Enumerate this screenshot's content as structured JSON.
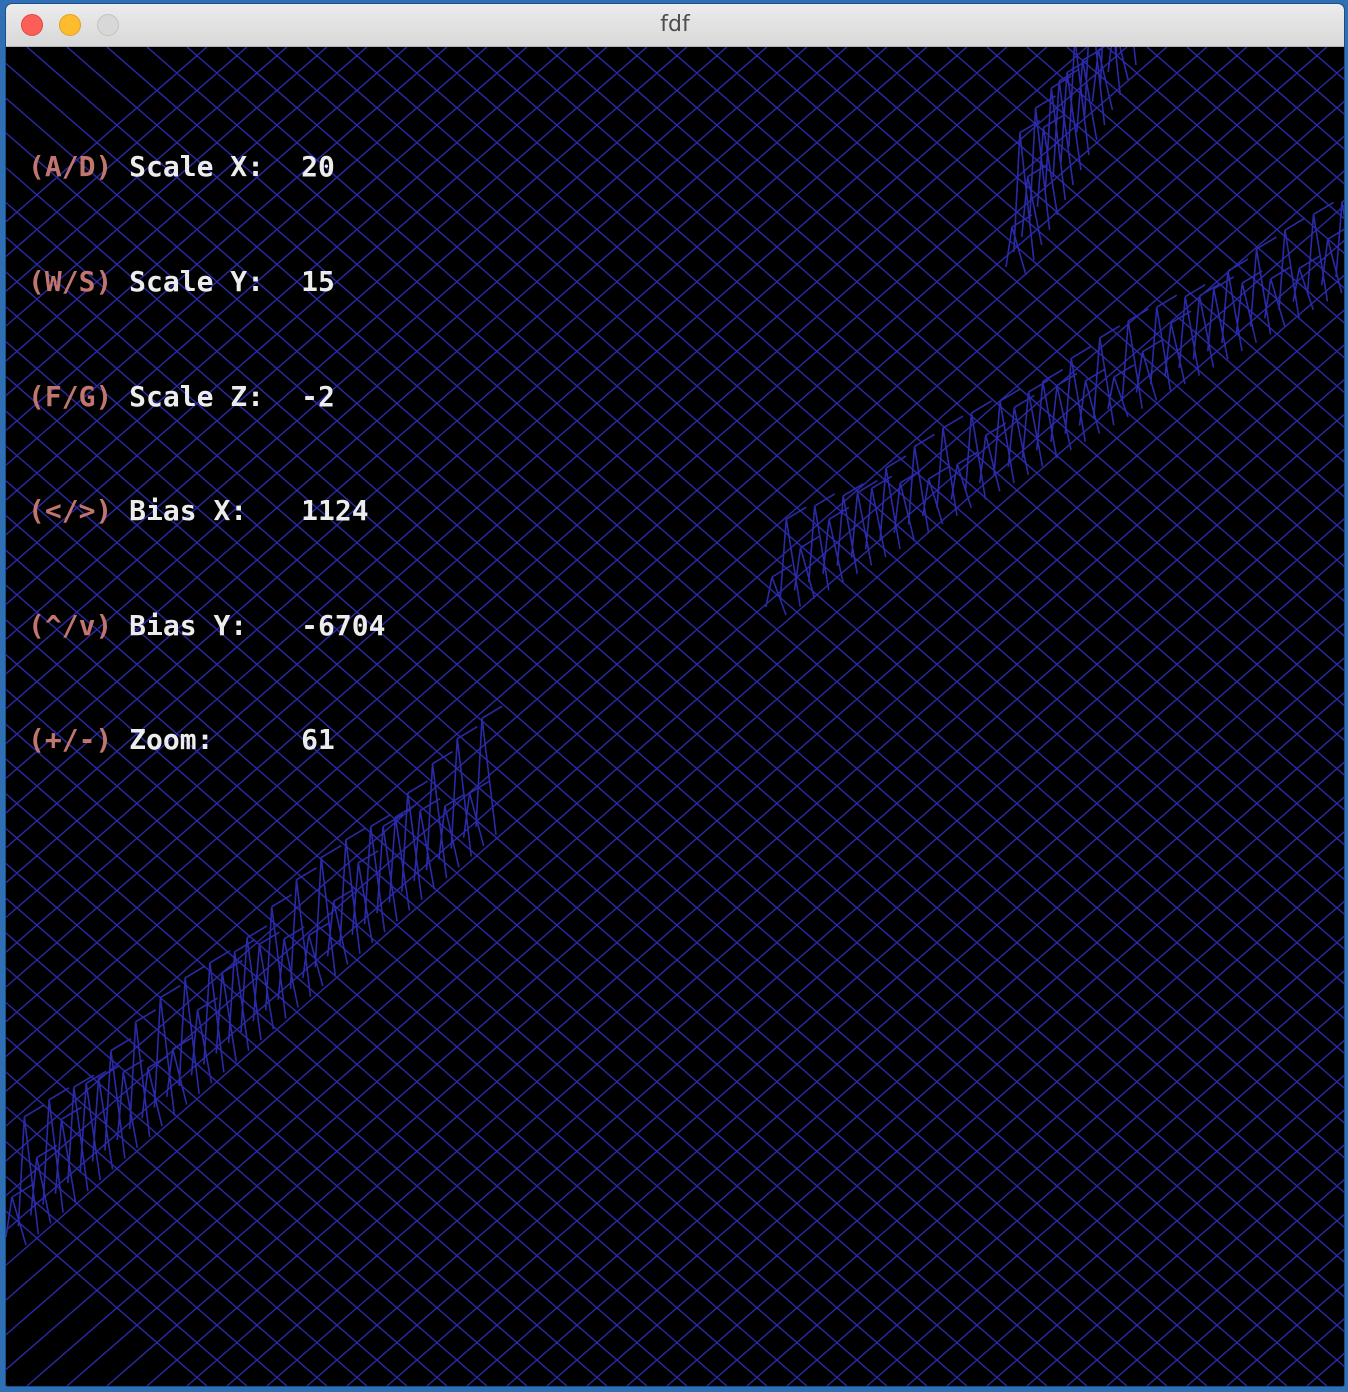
{
  "window": {
    "title": "fdf"
  },
  "hud": {
    "rows": [
      {
        "key": "(A/D)",
        "label": "Scale X:",
        "value": "20"
      },
      {
        "key": "(W/S)",
        "label": "Scale Y:",
        "value": "15"
      },
      {
        "key": "(F/G)",
        "label": "Scale Z:",
        "value": "-2"
      },
      {
        "key": "(</>)",
        "label": "Bias X:",
        "value": "1124"
      },
      {
        "key": "(^/v)",
        "label": "Bias Y:",
        "value": "-6704"
      },
      {
        "key": "(+/-)",
        "label": "Zoom:",
        "value": "61"
      }
    ]
  },
  "colors": {
    "wireframe": "#2a2aa8",
    "background": "#000000",
    "key_text": "#c0756f",
    "value_text": "#ececec"
  }
}
